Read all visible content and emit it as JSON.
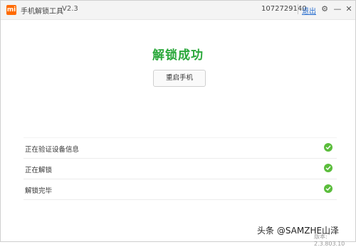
{
  "app": {
    "logo_text": "mi",
    "title": "手机解锁工具",
    "version": "V2.3",
    "account_id": "1072729140",
    "logout_label": "退出"
  },
  "result": {
    "title": "解锁成功",
    "restart_label": "重启手机"
  },
  "steps": [
    {
      "label": "正在验证设备信息",
      "status": "done"
    },
    {
      "label": "正在解锁",
      "status": "done"
    },
    {
      "label": "解锁完毕",
      "status": "done"
    }
  ],
  "footer": {
    "watermark": "头条 @SAMZHE山泽",
    "version_text": "版本: 2.3.803.10"
  },
  "colors": {
    "success": "#2aa83a",
    "check": "#5bbd3c",
    "brand": "#ff6a00"
  }
}
